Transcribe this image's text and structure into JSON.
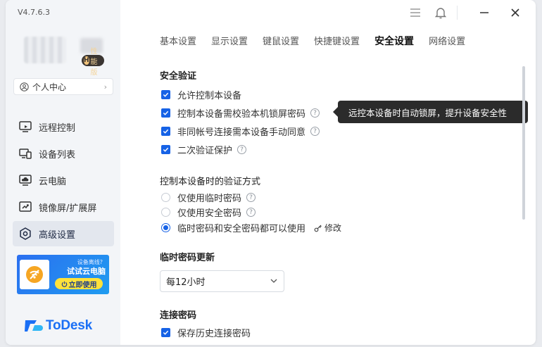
{
  "app": {
    "version": "V4.7.6.3",
    "badge_letter": "H",
    "badge_label": "性能版",
    "profile_label": "个人中心",
    "logo_text": "ToDesk",
    "accent": "#1662e6"
  },
  "sidebar": {
    "items": [
      {
        "label": "远程控制",
        "icon": "remote-control-icon"
      },
      {
        "label": "设备列表",
        "icon": "device-list-icon"
      },
      {
        "label": "云电脑",
        "icon": "cloud-pc-icon"
      },
      {
        "label": "镜像屏/扩展屏",
        "icon": "mirror-screen-icon"
      },
      {
        "label": "高级设置",
        "icon": "advanced-settings-icon",
        "active": true
      }
    ],
    "promo": {
      "line1": "设备离线?",
      "line2": "试试云电脑",
      "button": "立即使用"
    }
  },
  "tabs": [
    {
      "label": "基本设置"
    },
    {
      "label": "显示设置"
    },
    {
      "label": "键鼠设置"
    },
    {
      "label": "快捷键设置"
    },
    {
      "label": "安全设置",
      "active": true
    },
    {
      "label": "网络设置"
    }
  ],
  "security": {
    "title": "安全验证",
    "options": [
      {
        "label": "允许控制本设备",
        "checked": true
      },
      {
        "label": "控制本设备需校验本机锁屏密码",
        "checked": true,
        "help": true
      },
      {
        "label": "非同帐号连接需本设备手动同意",
        "checked": true,
        "help": true
      },
      {
        "label": "二次验证保护",
        "checked": true,
        "help": true
      }
    ],
    "tooltip": "远控本设备时自动锁屏，提升设备安全性"
  },
  "verify_method": {
    "title": "控制本设备时的验证方式",
    "options": [
      {
        "label": "仅使用临时密码",
        "selected": false,
        "help": true
      },
      {
        "label": "仅使用安全密码",
        "selected": false,
        "help": true
      },
      {
        "label": "临时密码和安全密码都可以使用",
        "selected": true
      }
    ],
    "modify_label": "修改"
  },
  "temp_password": {
    "title": "临时密码更新",
    "selected": "每12小时"
  },
  "connection_password": {
    "title": "连接密码",
    "options": [
      {
        "label": "保存历史连接密码",
        "checked": true
      }
    ]
  }
}
